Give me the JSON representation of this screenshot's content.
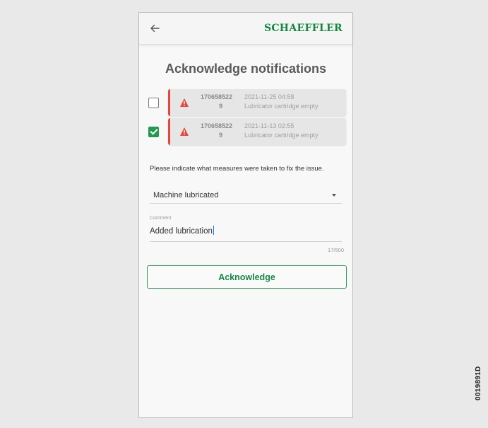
{
  "header": {
    "back_icon": "arrow-left-icon",
    "brand": "SCHAEFFLER",
    "brand_color": "#10893e"
  },
  "page": {
    "title": "Acknowledge notifications"
  },
  "notifications": [
    {
      "checked": false,
      "icon": "warning-triangle-icon",
      "id_line1": "170658522",
      "id_line2": "9",
      "datetime": "2021-11-25 04:58",
      "message": "Lubricator cartridge empty",
      "status_color": "#e8453c"
    },
    {
      "checked": true,
      "icon": "warning-triangle-icon",
      "id_line1": "170658522",
      "id_line2": "9",
      "datetime": "2021-11-13 02:55",
      "message": "Lubricator cartridge empty",
      "status_color": "#e8453c"
    }
  ],
  "form": {
    "instruction": "Please indicate what measures were taken to fix the issue.",
    "measure_value": "Machine lubricated",
    "comment_label": "Comment",
    "comment_value": "Added lubrication",
    "counter": "17/500"
  },
  "actions": {
    "acknowledge_label": "Acknowledge",
    "accent_color": "#2e9a58"
  },
  "figure_id": "0019891D"
}
